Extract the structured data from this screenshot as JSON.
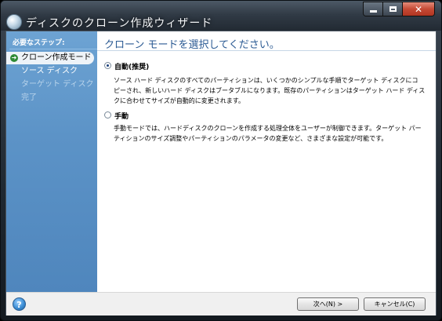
{
  "window": {
    "title": "ディスクのクローン作成ウィザード",
    "controls": {
      "minimize": "–",
      "maximize": "□",
      "close": "✕"
    }
  },
  "sidebar": {
    "header": "必要なステップ:",
    "steps": [
      {
        "label": "クローン作成モード",
        "state": "current"
      },
      {
        "label": "ソース ディスク",
        "state": "link"
      },
      {
        "label": "ターゲット ディスク",
        "state": "disabled"
      },
      {
        "label": "完了",
        "state": "disabled"
      }
    ]
  },
  "content": {
    "title": "クローン モードを選択してください。",
    "options": [
      {
        "label": "自動(推奨)",
        "checked": true,
        "description_lines": [
          "ソース ハード ディスクのすべてのパーティションは、いくつかのシンプルな手順でターゲット ディスクにコ",
          "ピーされ、新しいハード ディスクはブータブルになります。既存のパーティションはターゲット ハード ディス",
          "クに合わせてサイズが自動的に変更されます。"
        ]
      },
      {
        "label": "手動",
        "checked": false,
        "description_lines": [
          "手動モードでは、ハードディスクのクローンを作成する処理全体をユーザーが制御できます。ターゲット パー",
          "ティションのサイズ調整やパーティションのパラメータの変更など、さまざまな設定が可能です。"
        ]
      }
    ]
  },
  "footer": {
    "help_glyph": "?",
    "next_label": "次へ(N) >",
    "cancel_label": "キャンセル(C)"
  },
  "colors": {
    "sidebar": "#5c93c7",
    "title_text": "#2b5a93",
    "close_button": "#c54a35"
  }
}
